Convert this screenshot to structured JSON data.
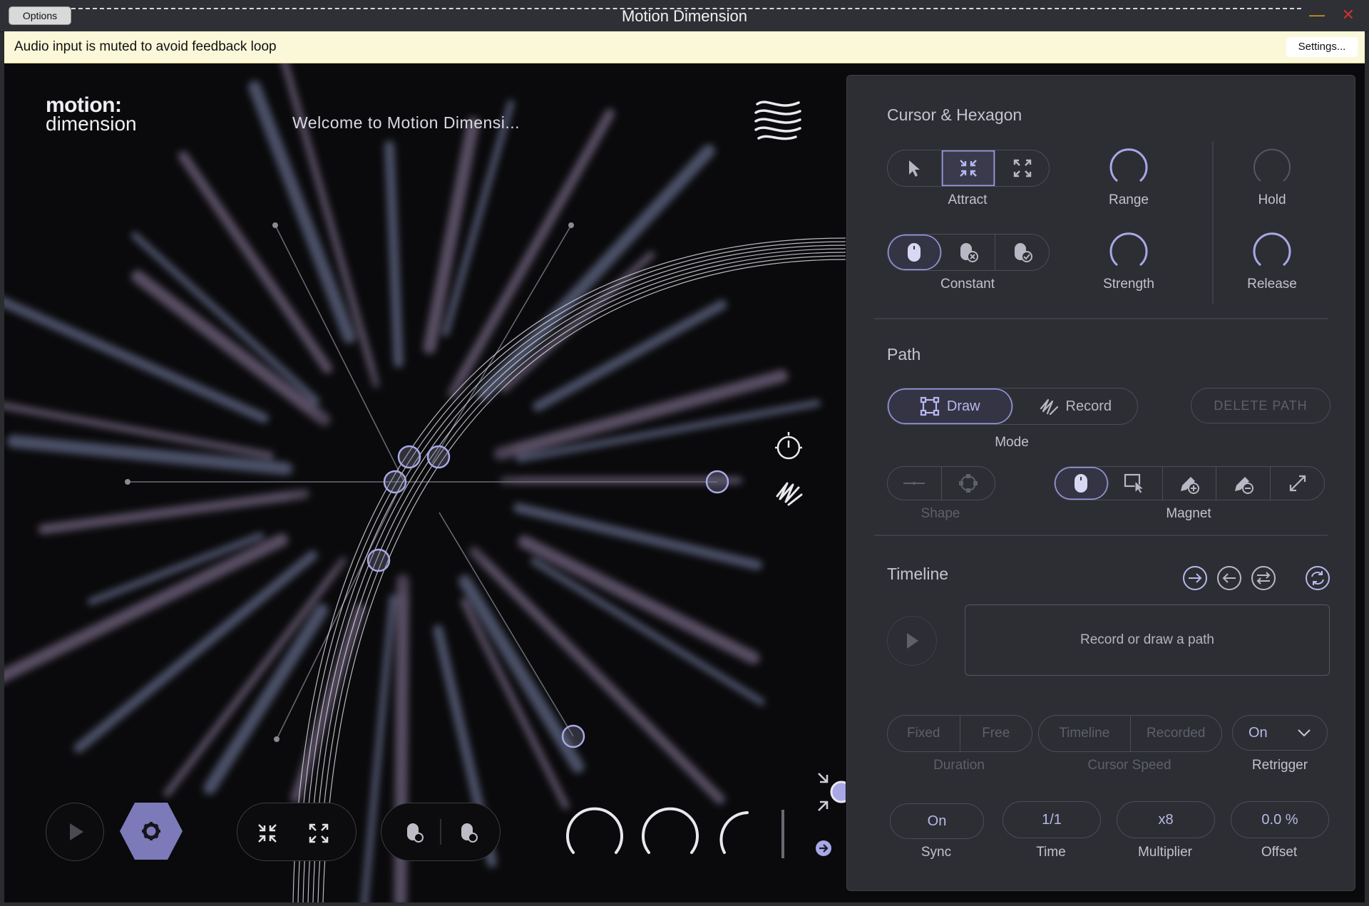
{
  "window": {
    "title": "Motion Dimension",
    "options_label": "Options",
    "minimize_glyph": "—",
    "close_glyph": "✕"
  },
  "notice": {
    "message": "Audio input is muted to avoid feedback loop",
    "settings_label": "Settings..."
  },
  "logo": {
    "line1": "motion:",
    "line2": "dimension"
  },
  "visual": {
    "welcome": "Welcome to Motion Dimensi..."
  },
  "panel": {
    "cursor": {
      "title": "Cursor & Hexagon",
      "mode_label": "Attract",
      "mode_selected": "attract",
      "hold_label": "Constant",
      "hold_selected": "constant",
      "range_label": "Range",
      "strength_label": "Strength",
      "hold_knob_label": "Hold",
      "release_label": "Release",
      "range_value": 0.5,
      "strength_value": 0.5,
      "hold_value": 0.3,
      "release_value": 0.5
    },
    "path": {
      "title": "Path",
      "draw_label": "Draw",
      "record_label": "Record",
      "delete_label": "DELETE PATH",
      "mode_label": "Mode",
      "shape_label": "Shape",
      "magnet_label": "Magnet"
    },
    "timeline": {
      "title": "Timeline",
      "placeholder": "Record or draw a path",
      "fixed": "Fixed",
      "free": "Free",
      "duration_label": "Duration",
      "timeline_opt": "Timeline",
      "recorded_opt": "Recorded",
      "cursor_speed_label": "Cursor Speed",
      "retrigger_value": "On",
      "retrigger_label": "Retrigger",
      "sync_value": "On",
      "sync_label": "Sync",
      "time_value": "1/1",
      "time_label": "Time",
      "multiplier_value": "x8",
      "multiplier_label": "Multiplier",
      "offset_value": "0.0 %",
      "offset_label": "Offset"
    }
  },
  "colors": {
    "accent": "#9c9ce6",
    "hex_button": "#7c7ab8",
    "panel_bg": "#2c2e34",
    "notice_bg": "#fbf8d9"
  }
}
